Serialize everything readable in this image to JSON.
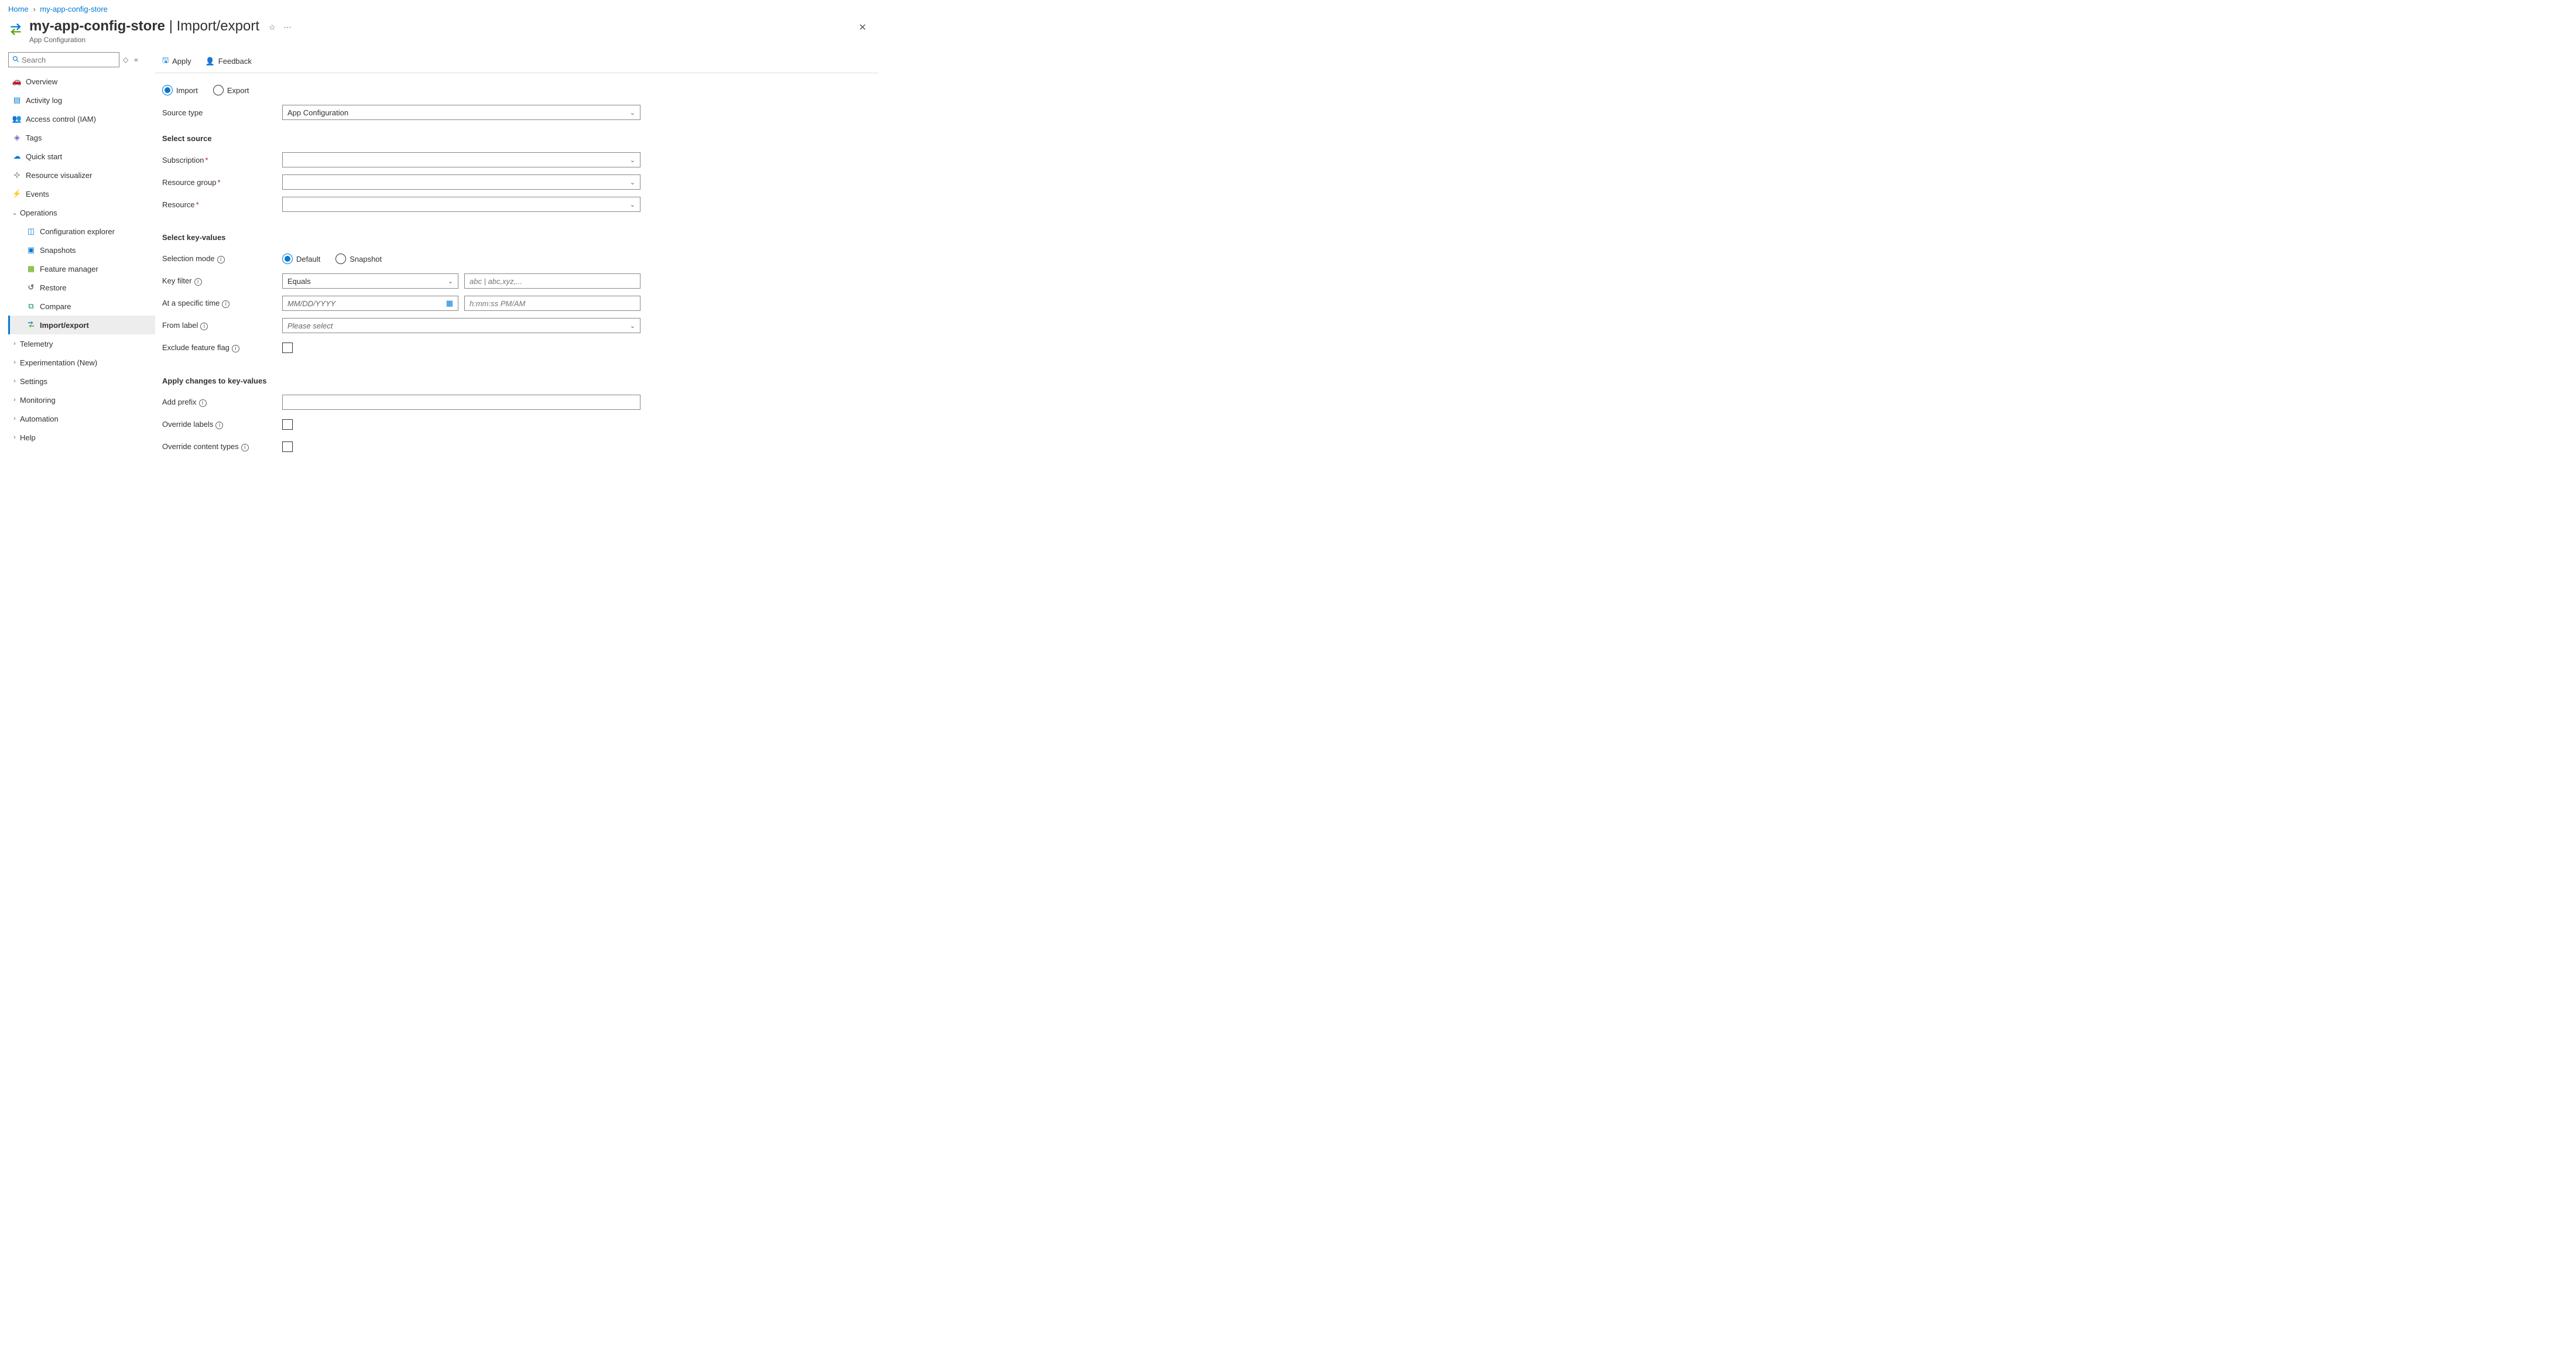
{
  "breadcrumb": {
    "home": "Home",
    "resource": "my-app-config-store"
  },
  "header": {
    "title": "my-app-config-store",
    "section": "Import/export",
    "subtitle": "App Configuration"
  },
  "sidebar": {
    "search_placeholder": "Search",
    "items": {
      "overview": "Overview",
      "activity_log": "Activity log",
      "iam": "Access control (IAM)",
      "tags": "Tags",
      "quick_start": "Quick start",
      "resource_viz": "Resource visualizer",
      "events": "Events",
      "operations": "Operations",
      "config_explorer": "Configuration explorer",
      "snapshots": "Snapshots",
      "feature_manager": "Feature manager",
      "restore": "Restore",
      "compare": "Compare",
      "import_export": "Import/export",
      "telemetry": "Telemetry",
      "experimentation": "Experimentation (New)",
      "settings": "Settings",
      "monitoring": "Monitoring",
      "automation": "Automation",
      "help": "Help"
    }
  },
  "toolbar": {
    "apply": "Apply",
    "feedback": "Feedback"
  },
  "form": {
    "mode": {
      "import": "Import",
      "export": "Export"
    },
    "source_type_label": "Source type",
    "source_type_value": "App Configuration",
    "select_source": "Select source",
    "subscription": "Subscription",
    "resource_group": "Resource group",
    "resource_label": "Resource",
    "select_kv": "Select key-values",
    "selection_mode": "Selection mode",
    "sm_default": "Default",
    "sm_snapshot": "Snapshot",
    "key_filter": "Key filter",
    "key_filter_op": "Equals",
    "key_filter_ph": "abc | abc,xyz,...",
    "at_time": "At a specific time",
    "date_ph": "MM/DD/YYYY",
    "time_ph": "h:mm:ss PM/AM",
    "from_label": "From label",
    "from_label_ph": "Please select",
    "exclude_ff": "Exclude feature flag",
    "apply_changes": "Apply changes to key-values",
    "add_prefix": "Add prefix",
    "override_labels": "Override labels",
    "override_ct": "Override content types"
  }
}
